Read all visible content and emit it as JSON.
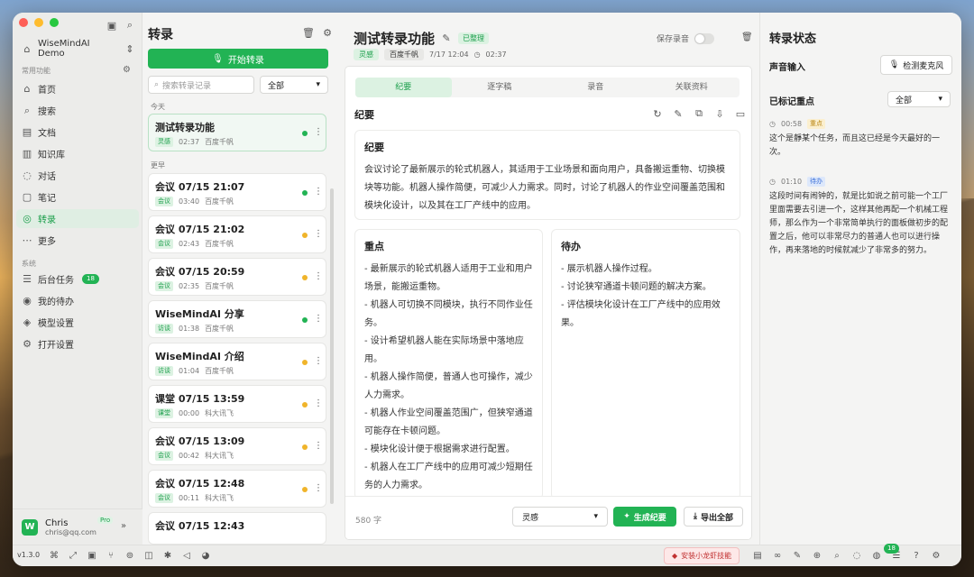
{
  "workspace": {
    "name": "WiseMindAI Demo"
  },
  "sidebar": {
    "section_common": "常用功能",
    "section_system": "系统",
    "common_items": [
      {
        "label": "首页",
        "icon": "home-icon"
      },
      {
        "label": "搜索",
        "icon": "search-icon"
      },
      {
        "label": "文档",
        "icon": "document-icon"
      },
      {
        "label": "知识库",
        "icon": "book-icon"
      },
      {
        "label": "对话",
        "icon": "chat-icon"
      },
      {
        "label": "笔记",
        "icon": "note-icon"
      },
      {
        "label": "转录",
        "icon": "transcribe-icon"
      },
      {
        "label": "更多",
        "icon": "more-icon"
      }
    ],
    "system_items": [
      {
        "label": "后台任务",
        "badge": "18"
      },
      {
        "label": "我的待办"
      },
      {
        "label": "模型设置"
      },
      {
        "label": "打开设置"
      }
    ],
    "user": {
      "initial": "W",
      "name": "Chris",
      "email": "chris@qq.com",
      "plan": "Pro"
    }
  },
  "list": {
    "title": "转录",
    "start_label": "开始转录",
    "search_placeholder": "搜索转录记录",
    "filter": "全部",
    "group_today": "今天",
    "group_earlier": "更早",
    "items": [
      {
        "title": "测试转录功能",
        "tag": "灵感",
        "duration": "02:37",
        "engine": "百度千帆",
        "status": "green",
        "tag_color": "green"
      },
      {
        "title": "会议 07/15 21:07",
        "tag": "会议",
        "duration": "03:40",
        "engine": "百度千帆",
        "status": "green",
        "tag_color": "green"
      },
      {
        "title": "会议 07/15 21:02",
        "tag": "会议",
        "duration": "02:43",
        "engine": "百度千帆",
        "status": "yellow",
        "tag_color": "green"
      },
      {
        "title": "会议 07/15 20:59",
        "tag": "会议",
        "duration": "02:35",
        "engine": "百度千帆",
        "status": "yellow",
        "tag_color": "green"
      },
      {
        "title": "WiseMindAI 分享",
        "tag": "访谈",
        "duration": "01:38",
        "engine": "百度千帆",
        "status": "green",
        "tag_color": "green"
      },
      {
        "title": "WiseMindAI 介绍",
        "tag": "访谈",
        "duration": "01:04",
        "engine": "百度千帆",
        "status": "yellow",
        "tag_color": "green"
      },
      {
        "title": "课堂 07/15 13:59",
        "tag": "课堂",
        "duration": "00:00",
        "engine": "科大讯飞",
        "status": "yellow",
        "tag_color": "green"
      },
      {
        "title": "会议 07/15 13:09",
        "tag": "会议",
        "duration": "00:42",
        "engine": "科大讯飞",
        "status": "yellow",
        "tag_color": "green"
      },
      {
        "title": "会议 07/15 12:48",
        "tag": "会议",
        "duration": "00:11",
        "engine": "科大讯飞",
        "status": "yellow",
        "tag_color": "green"
      },
      {
        "title": "会议 07/15 12:43",
        "tag": "",
        "duration": "",
        "engine": "",
        "status": "",
        "tag_color": "green"
      }
    ]
  },
  "main": {
    "title": "测试转录功能",
    "organized": "已整理",
    "tag1": "灵感",
    "tag2": "百度千帆",
    "datetime": "7/17 12:04",
    "duration": "02:37",
    "save_audio": "保存录音",
    "tabs": [
      "纪要",
      "逐字稿",
      "录音",
      "关联资料"
    ],
    "summary_header": "纪要",
    "summary": {
      "title": "纪要",
      "text": "会议讨论了最新展示的轮式机器人，其适用于工业场景和面向用户，具备搬运重物、切换模块等功能。机器人操作简便，可减少人力需求。同时，讨论了机器人的作业空间覆盖范围和模块化设计，以及其在工厂产线中的应用。"
    },
    "keypoints": {
      "title": "重点",
      "items": [
        "- 最新展示的轮式机器人适用于工业和用户场景，能搬运重物。",
        "- 机器人可切换不同模块，执行不同作业任务。",
        "- 设计希望机器人能在实际场景中落地应用。",
        "- 机器人操作简便，普通人也可操作，减少人力需求。",
        "- 机器人作业空间覆盖范围广，但狭窄通道可能存在卡顿问题。",
        "- 模块化设计便于根据需求进行配置。",
        "- 机器人在工厂产线中的应用可减少短期任务的人力需求。"
      ]
    },
    "todos": {
      "title": "待办",
      "items": [
        "- 展示机器人操作过程。",
        "- 讨论狭窄通道卡顿问题的解决方案。",
        "- 评估模块化设计在工厂产线中的应用效果。"
      ]
    },
    "word_count": "580 字",
    "style_select": "灵感",
    "generate_label": "生成纪要",
    "export_label": "导出全部"
  },
  "right": {
    "title": "转录状态",
    "voice_input": "声音输入",
    "mic_label": "检测麦克风",
    "marked_title": "已标记重点",
    "marked_filter": "全部",
    "marks": [
      {
        "time": "00:58",
        "tag": "重点",
        "text": "这个是靜某个任务，而且这已经是今天最好的一次。"
      },
      {
        "time": "01:10",
        "tag": "待办",
        "text": "这段时间有闹钟的，就是比如说之前可能一个工厂里面需要去引进一个，这样其他再配一个机械工程师，那么作为一个非常简单执行的面板做初步的配置之后，他可以非常尽力的普通人也可以进行操作，再来落地的时候就减少了非常多的努力。"
      }
    ]
  },
  "statusbar": {
    "version": "v1.3.0",
    "promo": "安装小龙虾技能",
    "todo_badge": "18"
  }
}
